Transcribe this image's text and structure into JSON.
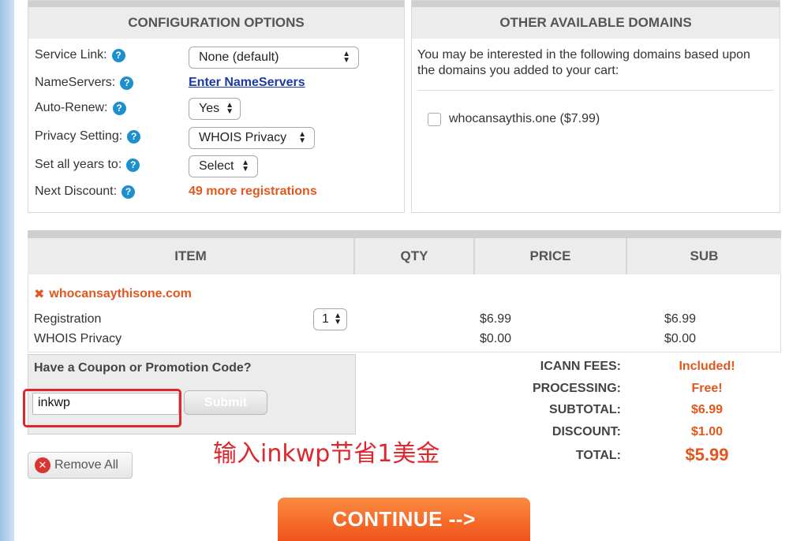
{
  "config": {
    "title": "CONFIGURATION OPTIONS",
    "rows": [
      {
        "label": "Service Link:"
      },
      {
        "label": "NameServers:"
      },
      {
        "label": "Auto-Renew:"
      },
      {
        "label": "Privacy Setting:"
      },
      {
        "label": "Set all years to:"
      },
      {
        "label": "Next Discount:"
      }
    ],
    "service_link_value": "None (default)",
    "nameservers_link": "Enter NameServers",
    "auto_renew_value": "Yes",
    "privacy_value": "WHOIS Privacy",
    "years_value": "Select",
    "next_discount": "49 more registrations"
  },
  "domains": {
    "title": "OTHER AVAILABLE DOMAINS",
    "intro": "You may be interested in the following domains based upon the domains you added to your cart:",
    "suggestions": [
      {
        "label": "whocansaythis.one ($7.99)"
      }
    ]
  },
  "cart": {
    "headers": {
      "item": "ITEM",
      "qty": "QTY",
      "price": "PRICE",
      "sub": "SUB"
    },
    "domain": "whocansaythisone.com",
    "lines": [
      {
        "name": "Registration",
        "price": "$6.99",
        "sub": "$6.99"
      },
      {
        "name": "WHOIS Privacy",
        "price": "$0.00",
        "sub": "$0.00"
      }
    ],
    "qty_value": "1"
  },
  "coupon": {
    "title": "Have a Coupon or Promotion Code?",
    "code": "inkwp",
    "submit": "Submit"
  },
  "annotation": "输入inkwp节省1美金",
  "totals": [
    {
      "label": "ICANN FEES:",
      "value": "Included!"
    },
    {
      "label": "PROCESSING:",
      "value": "Free!"
    },
    {
      "label": "SUBTOTAL:",
      "value": "$6.99"
    },
    {
      "label": "DISCOUNT:",
      "value": "$1.00"
    },
    {
      "label": "TOTAL:",
      "value": "$5.99"
    }
  ],
  "buttons": {
    "remove_all": "Remove All",
    "continue": "CONTINUE -->"
  },
  "colors": {
    "accent": "#e2571e",
    "link": "#1a3aa6",
    "help": "#1c8fcf",
    "highlight": "#e0262d"
  }
}
